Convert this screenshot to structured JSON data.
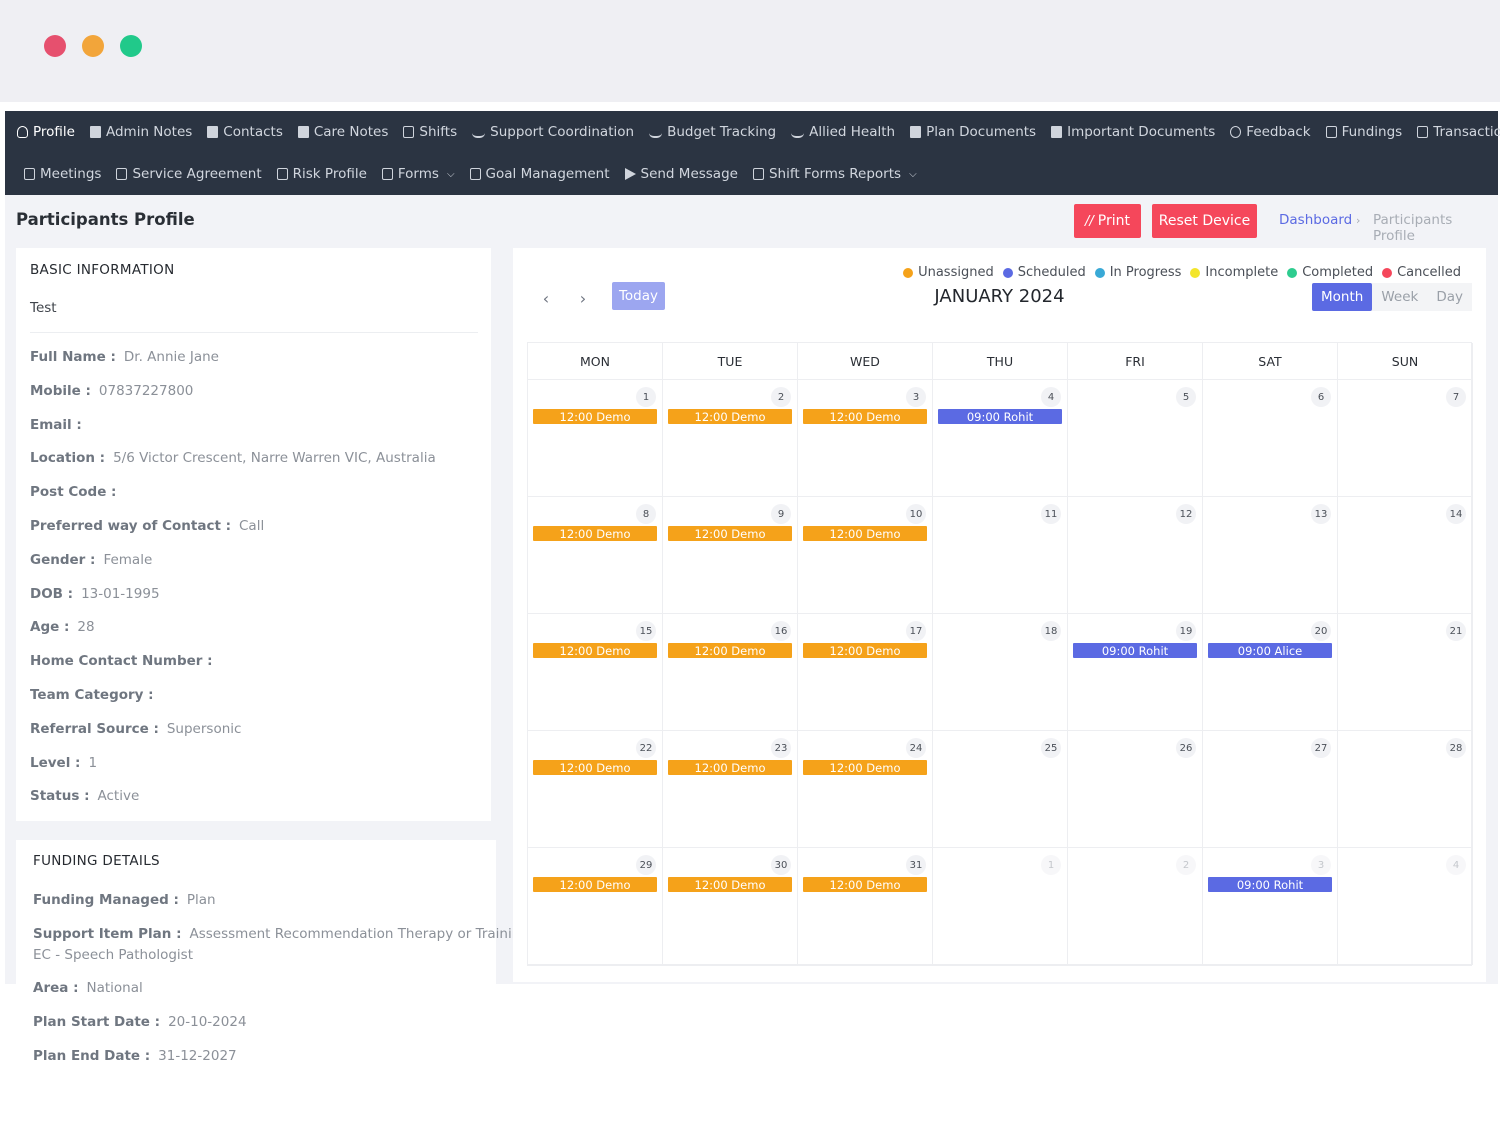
{
  "nav": {
    "row1": [
      {
        "label": "Profile",
        "icon": "user-icon",
        "active": true
      },
      {
        "label": "Admin Notes",
        "icon": "document-icon"
      },
      {
        "label": "Contacts",
        "icon": "document-icon"
      },
      {
        "label": "Care Notes",
        "icon": "document-icon"
      },
      {
        "label": "Shifts",
        "icon": "calendar-icon"
      },
      {
        "label": "Support Coordination",
        "icon": "users-icon"
      },
      {
        "label": "Budget Tracking",
        "icon": "users-icon"
      },
      {
        "label": "Allied Health",
        "icon": "users-icon"
      },
      {
        "label": "Plan Documents",
        "icon": "document-icon"
      },
      {
        "label": "Important Documents",
        "icon": "document-icon"
      },
      {
        "label": "Feedback",
        "icon": "chat-icon"
      },
      {
        "label": "Fundings",
        "icon": "wallet-icon"
      },
      {
        "label": "Transactions",
        "icon": "card-icon"
      }
    ],
    "row2": [
      {
        "label": "Meetings",
        "icon": "monitor-icon"
      },
      {
        "label": "Service Agreement",
        "icon": "edit-icon"
      },
      {
        "label": "Risk Profile",
        "icon": "edit-icon"
      },
      {
        "label": "Forms",
        "icon": "file-icon",
        "dropdown": true
      },
      {
        "label": "Goal Management",
        "icon": "target-icon"
      },
      {
        "label": "Send Message",
        "icon": "send-icon"
      },
      {
        "label": "Shift Forms Reports",
        "icon": "file-icon",
        "dropdown": true
      }
    ]
  },
  "header": {
    "title": "Participants Profile",
    "print_label": "Print",
    "reset_label": "Reset Device",
    "breadcrumb": [
      "Dashboard",
      "Participants Profile"
    ]
  },
  "basic_info": {
    "title": "BASIC INFORMATION",
    "subtitle": "Test",
    "fields": [
      {
        "k": "Full Name :",
        "v": "Dr. Annie Jane"
      },
      {
        "k": "Mobile :",
        "v": "07837227800"
      },
      {
        "k": "Email :",
        "v": ""
      },
      {
        "k": "Location :",
        "v": "5/6 Victor Crescent, Narre Warren VIC, Australia"
      },
      {
        "k": "Post Code :",
        "v": ""
      },
      {
        "k": "Preferred way of Contact :",
        "v": "Call"
      },
      {
        "k": "Gender :",
        "v": "Female"
      },
      {
        "k": "DOB :",
        "v": "13-01-1995"
      },
      {
        "k": "Age :",
        "v": "28"
      },
      {
        "k": "Home Contact Number :",
        "v": ""
      },
      {
        "k": "Team Category :",
        "v": ""
      },
      {
        "k": "Referral Source :",
        "v": "Supersonic"
      },
      {
        "k": "Level :",
        "v": "1"
      },
      {
        "k": "Status :",
        "v": "Active"
      }
    ]
  },
  "funding": {
    "title": "FUNDING DETAILS",
    "fields": [
      {
        "k": "Funding Managed :",
        "v": "Plan"
      },
      {
        "k": "Support Item Plan :",
        "v": "Assessment Recommendation Therapy or Training -",
        "v2": "EC - Speech Pathologist"
      },
      {
        "k": "Area :",
        "v": "National"
      },
      {
        "k": "Plan Start Date :",
        "v": "20-10-2024"
      },
      {
        "k": "Plan End Date :",
        "v": "31-12-2027"
      }
    ]
  },
  "calendar": {
    "title": "JANUARY 2024",
    "today_label": "Today",
    "views": [
      "Month",
      "Week",
      "Day"
    ],
    "active_view": "Month",
    "legend": [
      {
        "label": "Unassigned",
        "color": "#f5a21a"
      },
      {
        "label": "Scheduled",
        "color": "#5b6ae3"
      },
      {
        "label": "In Progress",
        "color": "#39a9d6"
      },
      {
        "label": "Incomplete",
        "color": "#f3e52b"
      },
      {
        "label": "Completed",
        "color": "#2ecc8f"
      },
      {
        "label": "Cancelled",
        "color": "#f5475b"
      }
    ],
    "days_of_week": [
      "MON",
      "TUE",
      "WED",
      "THU",
      "FRI",
      "SAT",
      "SUN"
    ],
    "weeks": [
      [
        {
          "d": "1",
          "e": {
            "t": "12:00 Demo",
            "s": "Unassigned"
          }
        },
        {
          "d": "2",
          "e": {
            "t": "12:00 Demo",
            "s": "Unassigned"
          }
        },
        {
          "d": "3",
          "e": {
            "t": "12:00 Demo",
            "s": "Unassigned"
          }
        },
        {
          "d": "4",
          "e": {
            "t": "09:00 Rohit",
            "s": "Scheduled"
          }
        },
        {
          "d": "5"
        },
        {
          "d": "6"
        },
        {
          "d": "7"
        }
      ],
      [
        {
          "d": "8",
          "e": {
            "t": "12:00 Demo",
            "s": "Unassigned"
          }
        },
        {
          "d": "9",
          "e": {
            "t": "12:00 Demo",
            "s": "Unassigned"
          }
        },
        {
          "d": "10",
          "e": {
            "t": "12:00 Demo",
            "s": "Unassigned"
          }
        },
        {
          "d": "11"
        },
        {
          "d": "12"
        },
        {
          "d": "13"
        },
        {
          "d": "14"
        }
      ],
      [
        {
          "d": "15",
          "e": {
            "t": "12:00 Demo",
            "s": "Unassigned"
          }
        },
        {
          "d": "16",
          "e": {
            "t": "12:00 Demo",
            "s": "Unassigned"
          }
        },
        {
          "d": "17",
          "e": {
            "t": "12:00 Demo",
            "s": "Unassigned"
          }
        },
        {
          "d": "18"
        },
        {
          "d": "19",
          "e": {
            "t": "09:00 Rohit",
            "s": "Scheduled"
          }
        },
        {
          "d": "20",
          "e": {
            "t": "09:00 Alice",
            "s": "Scheduled"
          }
        },
        {
          "d": "21"
        }
      ],
      [
        {
          "d": "22",
          "e": {
            "t": "12:00 Demo",
            "s": "Unassigned"
          }
        },
        {
          "d": "23",
          "e": {
            "t": "12:00 Demo",
            "s": "Unassigned"
          }
        },
        {
          "d": "24",
          "e": {
            "t": "12:00 Demo",
            "s": "Unassigned"
          }
        },
        {
          "d": "25"
        },
        {
          "d": "26"
        },
        {
          "d": "27"
        },
        {
          "d": "28"
        }
      ],
      [
        {
          "d": "29",
          "e": {
            "t": "12:00 Demo",
            "s": "Unassigned"
          }
        },
        {
          "d": "30",
          "e": {
            "t": "12:00 Demo",
            "s": "Unassigned"
          }
        },
        {
          "d": "31",
          "e": {
            "t": "12:00 Demo",
            "s": "Unassigned"
          }
        },
        {
          "d": "1",
          "other": true
        },
        {
          "d": "2",
          "other": true
        },
        {
          "d": "3",
          "other": true,
          "e": {
            "t": "09:00 Rohit",
            "s": "Scheduled"
          }
        },
        {
          "d": "4",
          "other": true
        }
      ]
    ]
  },
  "colors": {
    "nav_bg": "#2b3442",
    "accent": "#5b6ae3",
    "danger": "#f5475b",
    "unassigned": "#f5a21a",
    "scheduled": "#5b6ae3",
    "window_red": "#e6506e",
    "window_yellow": "#f2a53a",
    "window_green": "#21c98a"
  }
}
